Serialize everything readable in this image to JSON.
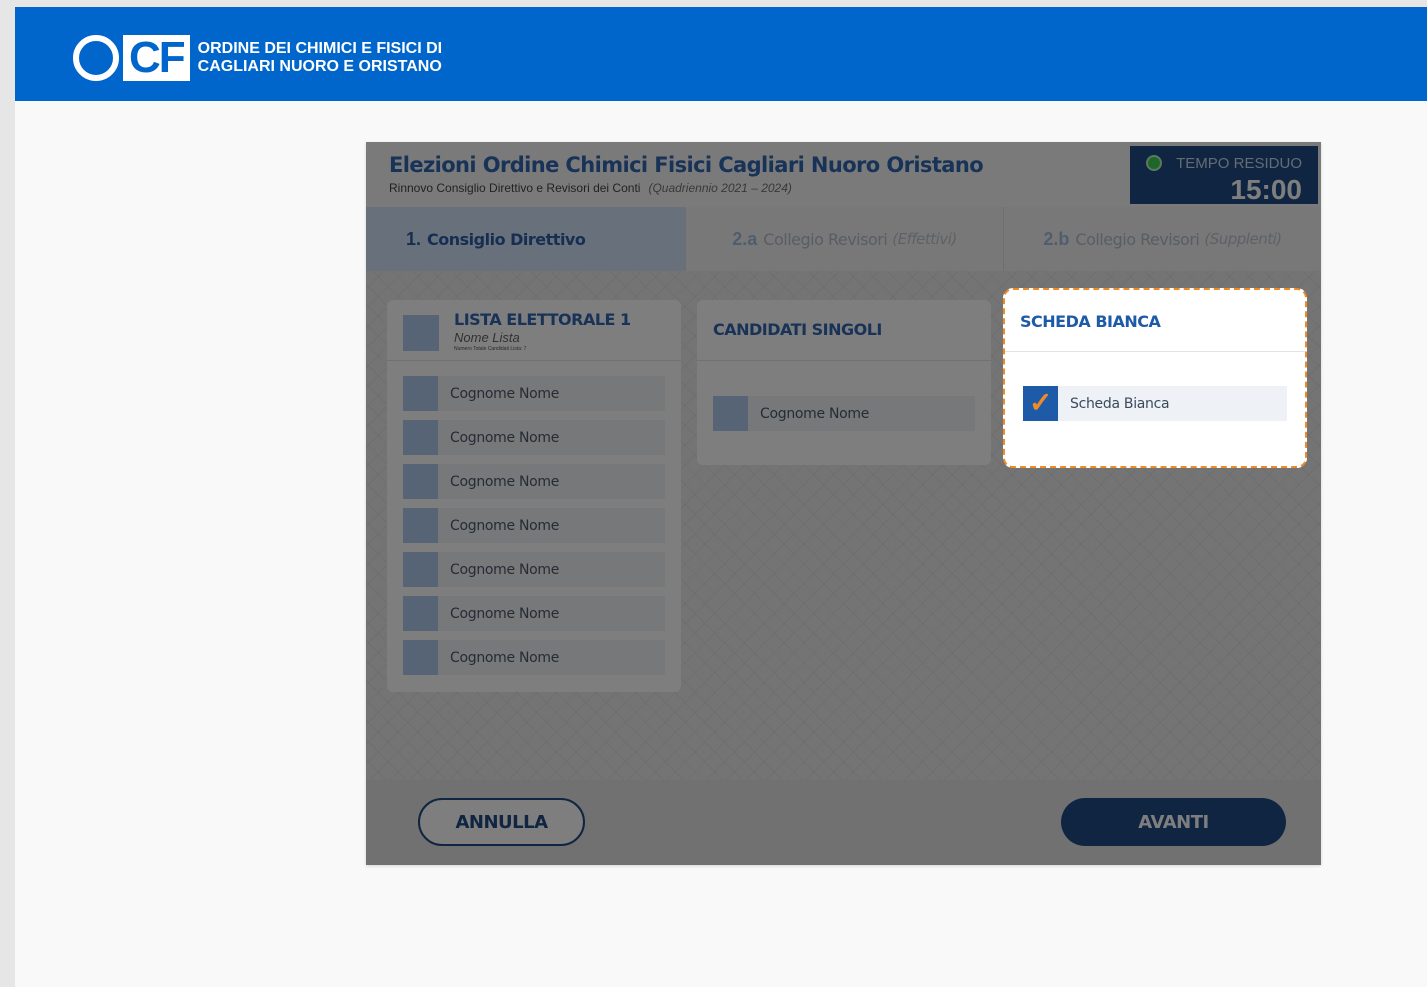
{
  "brand": {
    "logo_o": "O",
    "logo_cf": "CF",
    "line1": "ORDINE DEI CHIMICI E FISICI DI",
    "line2": "CAGLIARI NUORO E ORISTANO"
  },
  "panel": {
    "title": "Elezioni Ordine Chimici Fisici Cagliari Nuoro Oristano",
    "subtitle": "Rinnovo Consiglio Direttivo e Revisori dei Conti",
    "period": "(Quadriennio 2021 – 2024)",
    "timer": {
      "label": "TEMPO RESIDUO",
      "value": "15:00"
    }
  },
  "tabs": [
    {
      "num": "1.",
      "label": "Consiglio Direttivo",
      "sub": ""
    },
    {
      "num": "2.a",
      "label": "Collegio Revisori",
      "sub": "(Effettivi)"
    },
    {
      "num": "2.b",
      "label": "Collegio Revisori",
      "sub": "(Supplenti)"
    }
  ],
  "lista": {
    "title": "LISTA ELETTORALE 1",
    "name": "Nome Lista",
    "note": "Numero Totale Candidati Lista: 7",
    "candidates": [
      "Cognome Nome",
      "Cognome Nome",
      "Cognome Nome",
      "Cognome Nome",
      "Cognome Nome",
      "Cognome Nome",
      "Cognome Nome"
    ]
  },
  "singoli": {
    "title": "CANDIDATI SINGOLI",
    "candidates": [
      "Cognome Nome"
    ]
  },
  "bianca": {
    "title": "SCHEDA BIANCA",
    "option": "Scheda Bianca",
    "checked": true,
    "check_glyph": "✓"
  },
  "footer": {
    "cancel": "ANNULLA",
    "next": "AVANTI"
  },
  "colors": {
    "brand_blue": "#0066cc",
    "dark_blue": "#0a3a78",
    "accent_orange": "#f08a24",
    "timer_green": "#2ecc40"
  }
}
